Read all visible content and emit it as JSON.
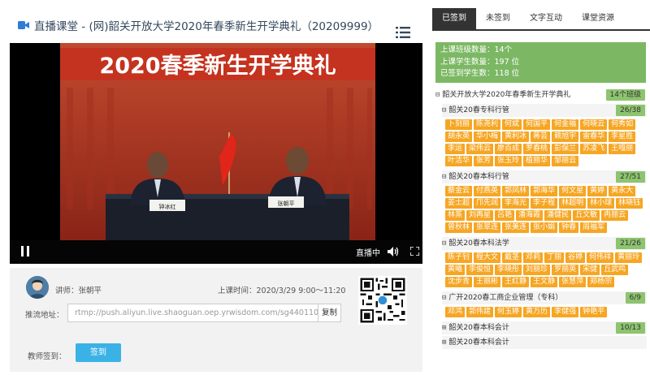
{
  "title": "直播课堂 - (网)韶关开放大学2020年春季新生开学典礼（20209999）",
  "video": {
    "banner_text": "2020春季新生开学典礼",
    "nameplate_left": "钟冰红",
    "nameplate_right": "张朝平",
    "live_label": "直播中"
  },
  "info": {
    "teacher": "讲师：张朝平",
    "schedule": "上课时间：2020/3/29 9:00～11:20",
    "push_label": "推流地址：",
    "push_url": "rtmp://push.aliyun.live.shaoguan.oep.yrwisdom.com/sg440110",
    "copy_label": "复制",
    "sign_label": "教师签到：",
    "sign_button": "签到"
  },
  "tabs": [
    "已签到",
    "未签到",
    "文字互动",
    "课堂资源"
  ],
  "stats": {
    "classes": "上课班级数量：14个",
    "students": "上课学生数量：197 位",
    "signed": "已签到学生数：118 位"
  },
  "tree": {
    "root_label": "韶关开放大学2020年春季新生开学典礼",
    "root_badge": "14个班级",
    "groups": [
      {
        "label": "韶关20春专科行管",
        "badge": "26/38",
        "members": [
          "卜刻丽",
          "陈尧利",
          "何斌",
          "何国平",
          "何金福",
          "何晓云",
          "何秀如",
          "胡永英",
          "华小梅",
          "黄利冰",
          "蒋芸",
          "赖旭宇",
          "雷春华",
          "李星胜",
          "李运",
          "梁伟云",
          "廖百成",
          "罗春桃",
          "彭保兰",
          "苏凌飞",
          "王嘎丽",
          "叶洁华",
          "张芳",
          "张玉玲",
          "植丽华",
          "邹丽云"
        ]
      },
      {
        "label": "韶关20春本科行管",
        "badge": "27/51",
        "members": [
          "蔡金云",
          "付燕英",
          "郭凤林",
          "郭海华",
          "何文星",
          "黄婷",
          "黄永大",
          "姜士超",
          "邝先润",
          "李海光",
          "李子程",
          "林超明",
          "林小球",
          "林晓钰",
          "林蒸",
          "刘再星",
          "吕艳",
          "潘海霞",
          "潘健民",
          "丘文敏",
          "冉丽云",
          "曾秋林",
          "张翠连",
          "张美连",
          "张小娟",
          "钟春",
          "周福军"
        ]
      },
      {
        "label": "韶关20春本科法学",
        "badge": "21/26",
        "members": [
          "陈子钊",
          "程大文",
          "戴茎",
          "邓莉",
          "丁丽",
          "谷婷",
          "何伟祥",
          "黄丽玲",
          "黄曦",
          "李俊恒",
          "李晓彤",
          "刘丽珍",
          "罗丽英",
          "宋健",
          "丘武鸣",
          "沈步青",
          "王丽彬",
          "王红静",
          "王文静",
          "张慧萍",
          "郑杨宗"
        ]
      },
      {
        "label": "广开2020春工商企业管理（专科）",
        "badge": "6/9",
        "members": [
          "邓鸿",
          "郭伟建",
          "何玉婷",
          "黄万历",
          "李健强",
          "钟艳平"
        ]
      },
      {
        "label": "韶关20春本科会计",
        "badge": "10/13",
        "members": []
      },
      {
        "label": "韶关20春本科会计",
        "badge": "",
        "members": []
      }
    ]
  },
  "colors": {
    "chip": "#f6a623",
    "stats_bg": "#7cb864",
    "badge_bg": "#8dc46f",
    "sign_button": "#3ab2e6",
    "tab_active": "#333333"
  }
}
